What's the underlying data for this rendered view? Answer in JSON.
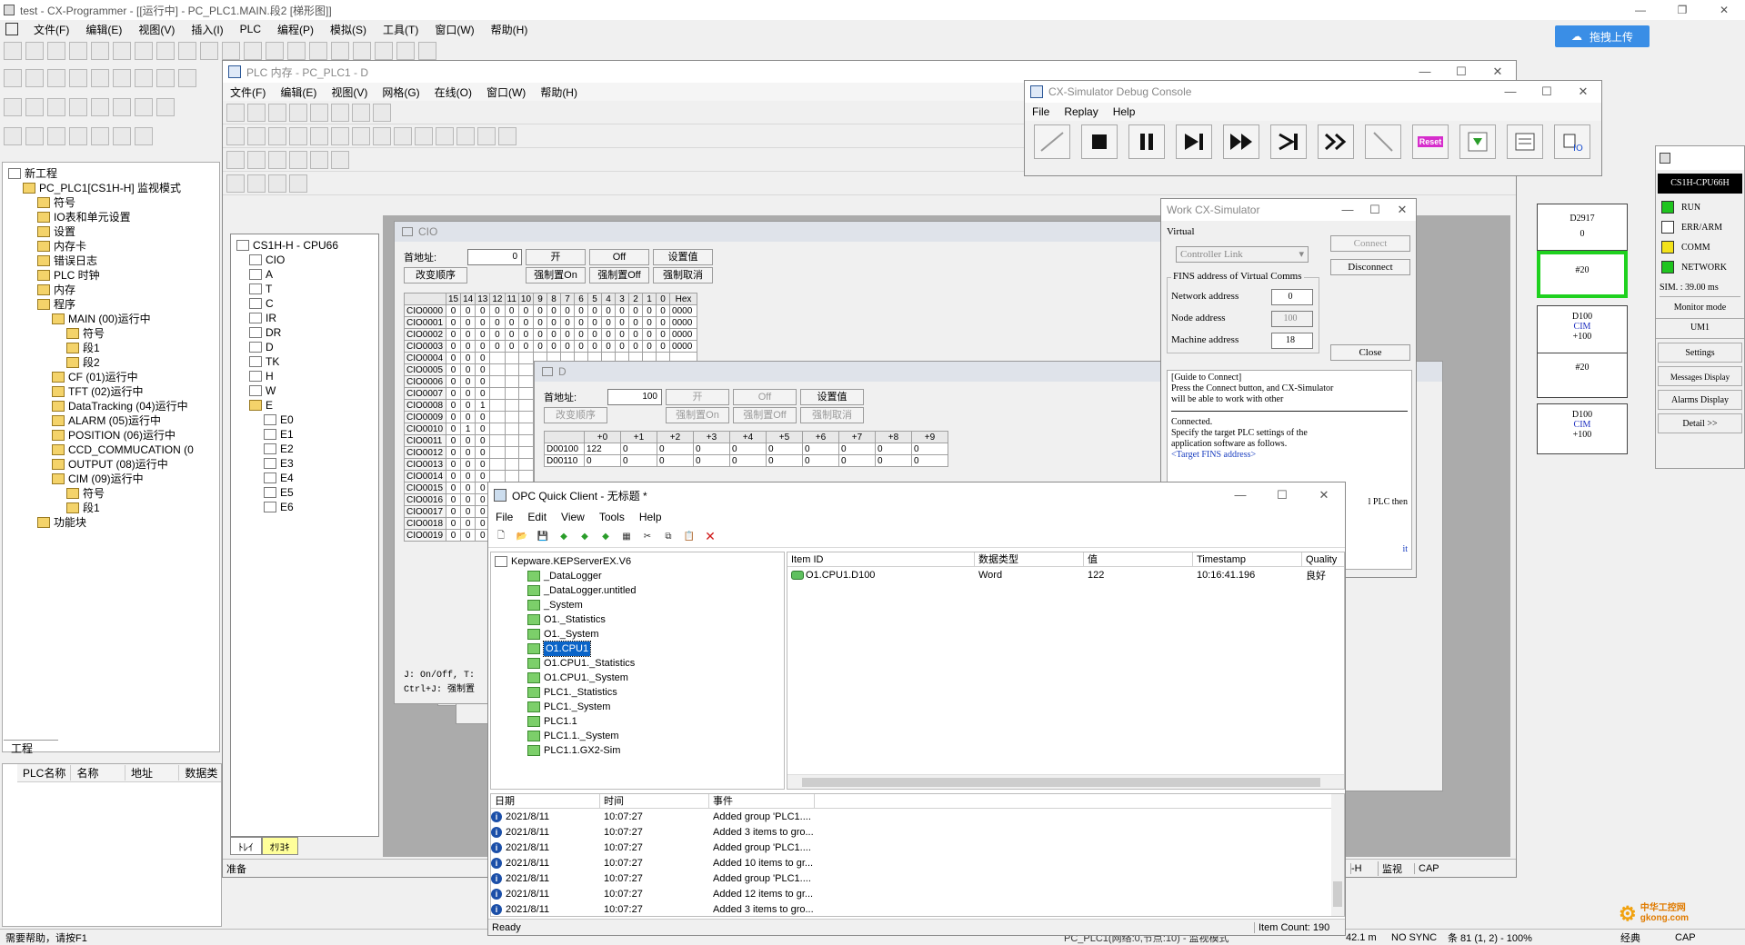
{
  "main_window": {
    "title": "test - CX-Programmer - [[运行中] - PC_PLC1.MAIN.段2 [梯形图]]",
    "menu": [
      "文件(F)",
      "编辑(E)",
      "视图(V)",
      "插入(I)",
      "PLC",
      "编程(P)",
      "模拟(S)",
      "工具(T)",
      "窗口(W)",
      "帮助(H)"
    ],
    "upload_button": "拖拽上传",
    "status_help": "需要帮助，请按F1",
    "status_right": {
      "plc_info": "PC_PLC1(网络:0,节点:10) - 监视模式",
      "time": "42.1 m",
      "sync": "NO SYNC",
      "position": "条 81 (1, 2)  - 100%",
      "mode": "经典",
      "cap": "CAP"
    }
  },
  "project_tree": {
    "items": [
      {
        "label": "新工程",
        "indent": 0
      },
      {
        "label": "PC_PLC1[CS1H-H] 监视模式",
        "indent": 1
      },
      {
        "label": "符号",
        "indent": 2
      },
      {
        "label": "IO表和单元设置",
        "indent": 2
      },
      {
        "label": "设置",
        "indent": 2
      },
      {
        "label": "内存卡",
        "indent": 2
      },
      {
        "label": "错误日志",
        "indent": 2
      },
      {
        "label": "PLC 时钟",
        "indent": 2
      },
      {
        "label": "内存",
        "indent": 2
      },
      {
        "label": "程序",
        "indent": 2
      },
      {
        "label": "MAIN (00)运行中",
        "indent": 3
      },
      {
        "label": "符号",
        "indent": 4
      },
      {
        "label": "段1",
        "indent": 4
      },
      {
        "label": "段2",
        "indent": 4
      },
      {
        "label": "CF (01)运行中",
        "indent": 3
      },
      {
        "label": "TFT (02)运行中",
        "indent": 3
      },
      {
        "label": "DataTracking (04)运行中",
        "indent": 3
      },
      {
        "label": "ALARM (05)运行中",
        "indent": 3
      },
      {
        "label": "POSITION (06)运行中",
        "indent": 3
      },
      {
        "label": "CCD_COMMUCATION (0",
        "indent": 3
      },
      {
        "label": "OUTPUT (08)运行中",
        "indent": 3
      },
      {
        "label": "CIM (09)运行中",
        "indent": 3
      },
      {
        "label": "符号",
        "indent": 4
      },
      {
        "label": "段1",
        "indent": 4
      },
      {
        "label": "功能块",
        "indent": 2
      }
    ],
    "tab": "工程"
  },
  "symbol_table": {
    "headers": [
      "PLC名称",
      "名称",
      "地址",
      "数据类"
    ]
  },
  "plc_memory": {
    "title": "PLC 内存 - PC_PLC1 - D",
    "menu": [
      "文件(F)",
      "编辑(E)",
      "视图(V)",
      "网格(G)",
      "在线(O)",
      "窗口(W)",
      "帮助(H)"
    ],
    "tree_root": "CS1H-H - CPU66",
    "areas": [
      "CIO",
      "A",
      "T",
      "C",
      "IR",
      "DR",
      "D",
      "TK",
      "H",
      "W",
      "E",
      "E0",
      "E1",
      "E2",
      "E3",
      "E4",
      "E5",
      "E6"
    ],
    "tabs": [
      "ﾄﾚｲ",
      "ｵﾘﾖｷ"
    ],
    "status": "准备",
    "status_right": [
      "-H",
      "监视",
      "CAP"
    ]
  },
  "cio_window": {
    "title": "CIO",
    "start_label": "首地址:",
    "start_value": "0",
    "buttons_row1": [
      "开",
      "Off",
      "设置值"
    ],
    "buttons_row2": [
      "改变顺序",
      "强制置On",
      "强制置Off",
      "强制取消"
    ],
    "bit_headers": [
      "15",
      "14",
      "13",
      "12",
      "11",
      "10",
      "9",
      "8",
      "7",
      "6",
      "5",
      "4",
      "3",
      "2",
      "1",
      "0",
      "Hex"
    ],
    "rows": [
      {
        "addr": "CIO0000",
        "bits": [
          "0",
          "0",
          "0",
          "0",
          "0",
          "0",
          "0",
          "0",
          "0",
          "0",
          "0",
          "0",
          "0",
          "0",
          "0",
          "0"
        ],
        "hex": "0000"
      },
      {
        "addr": "CIO0001",
        "bits": [
          "0",
          "0",
          "0",
          "0",
          "0",
          "0",
          "0",
          "0",
          "0",
          "0",
          "0",
          "0",
          "0",
          "0",
          "0",
          "0"
        ],
        "hex": "0000"
      },
      {
        "addr": "CIO0002",
        "bits": [
          "0",
          "0",
          "0",
          "0",
          "0",
          "0",
          "0",
          "0",
          "0",
          "0",
          "0",
          "0",
          "0",
          "0",
          "0",
          "0"
        ],
        "hex": "0000"
      },
      {
        "addr": "CIO0003",
        "bits": [
          "0",
          "0",
          "0",
          "0",
          "0",
          "0",
          "0",
          "0",
          "0",
          "0",
          "0",
          "0",
          "0",
          "0",
          "0",
          "0"
        ],
        "hex": "0000"
      },
      {
        "addr": "CIO0004",
        "bits": [
          "0",
          "0",
          "0",
          "",
          "",
          "",
          "",
          "",
          "",
          "",
          "",
          "",
          "",
          "",
          "",
          ""
        ],
        "hex": ""
      },
      {
        "addr": "CIO0005",
        "bits": [
          "0",
          "0",
          "0"
        ],
        "hex": ""
      },
      {
        "addr": "CIO0006",
        "bits": [
          "0",
          "0",
          "0"
        ],
        "hex": ""
      },
      {
        "addr": "CIO0007",
        "bits": [
          "0",
          "0",
          "0"
        ],
        "hex": ""
      },
      {
        "addr": "CIO0008",
        "bits": [
          "0",
          "0",
          "1"
        ],
        "hex": ""
      },
      {
        "addr": "CIO0009",
        "bits": [
          "0",
          "0",
          "0"
        ],
        "hex": ""
      },
      {
        "addr": "CIO0010",
        "bits": [
          "0",
          "1",
          "0"
        ],
        "hex": ""
      },
      {
        "addr": "CIO0011",
        "bits": [
          "0",
          "0",
          "0"
        ],
        "hex": ""
      },
      {
        "addr": "CIO0012",
        "bits": [
          "0",
          "0",
          "0"
        ],
        "hex": ""
      },
      {
        "addr": "CIO0013",
        "bits": [
          "0",
          "0",
          "0"
        ],
        "hex": ""
      },
      {
        "addr": "CIO0014",
        "bits": [
          "0",
          "0",
          "0"
        ],
        "hex": ""
      },
      {
        "addr": "CIO0015",
        "bits": [
          "0",
          "0",
          "0"
        ],
        "hex": ""
      },
      {
        "addr": "CIO0016",
        "bits": [
          "0",
          "0",
          "0"
        ],
        "hex": ""
      },
      {
        "addr": "CIO0017",
        "bits": [
          "0",
          "0",
          "0"
        ],
        "hex": ""
      },
      {
        "addr": "CIO0018",
        "bits": [
          "0",
          "0",
          "0"
        ],
        "hex": ""
      },
      {
        "addr": "CIO0019",
        "bits": [
          "0",
          "0",
          "0"
        ],
        "hex": ""
      }
    ],
    "hint1": "J: On/Off,  T:",
    "hint2": "Ctrl+J: 强制置"
  },
  "d_window": {
    "title": "D",
    "start_label": "首地址:",
    "start_value": "100",
    "buttons_row1": [
      "开",
      "Off",
      "设置值"
    ],
    "buttons_row2": [
      "改变顺序",
      "强制置On",
      "强制置Off",
      "强制取消"
    ],
    "col_headers": [
      "+0",
      "+1",
      "+2",
      "+3",
      "+4",
      "+5",
      "+6",
      "+7",
      "+8",
      "+9"
    ],
    "rows": [
      {
        "addr": "D00100",
        "values": [
          "122",
          "0",
          "0",
          "0",
          "0",
          "0",
          "0",
          "0",
          "0",
          "0"
        ]
      },
      {
        "addr": "D00110",
        "values": [
          "0",
          "0",
          "0",
          "0",
          "0",
          "0",
          "0",
          "0",
          "0",
          "0"
        ]
      }
    ]
  },
  "debug_console": {
    "title": "CX-Simulator Debug Console",
    "menu": [
      "File",
      "Replay",
      "Help"
    ],
    "reset_label": "Reset"
  },
  "work_sim": {
    "title": "Work CX-Simulator",
    "virtual_label": "Virtual",
    "controller_link": "Controller Link",
    "connect": "Connect",
    "disconnect": "Disconnect",
    "fins_label": "FINS address of Virtual Comms",
    "network_label": "Network address",
    "network_value": "0",
    "node_label": "Node address",
    "node_value": "100",
    "machine_label": "Machine address",
    "machine_value": "18",
    "close": "Close",
    "guide_lines": [
      "[Guide to Connect]",
      "Press the Connect button, and CX-Simulator",
      "will be able to work with other"
    ],
    "connected_lines": [
      "Connected.",
      "Specify the target PLC settings of the",
      "application software as follows."
    ],
    "target_fins": "<Target FINS address>",
    "frag_then": "l PLC then",
    "frag_it": "it"
  },
  "sim_panel": {
    "model": "CS1H-CPU66H",
    "leds": [
      {
        "label": "RUN",
        "color": "#1fc41f"
      },
      {
        "label": "ERR/ARM",
        "color": "#ffffff"
      },
      {
        "label": "COMM",
        "color": "#f3e21a"
      },
      {
        "label": "NETWORK",
        "color": "#1fc41f"
      }
    ],
    "sim_time": "SIM. : 39.00 ms",
    "monitor_mode": "Monitor mode",
    "um": "UM1",
    "settings": "Settings",
    "messages": "Messages Display",
    "alarms": "Alarms Display",
    "detail": "Detail >>"
  },
  "ladder_cells": [
    {
      "top": "D2917",
      "bottom": "0"
    },
    {
      "top": "#20",
      "bottom": ""
    },
    {
      "top": "D100",
      "mid": "CIM",
      "bottom": "+100"
    },
    {
      "top": "#20",
      "bottom": ""
    },
    {
      "top": "D100",
      "mid": "CIM",
      "bottom": "+100"
    }
  ],
  "opc": {
    "title": "OPC Quick Client - 无标题 *",
    "menu": [
      "File",
      "Edit",
      "View",
      "Tools",
      "Help"
    ],
    "tree": [
      {
        "label": "Kepware.KEPServerEX.V6",
        "indent": 0
      },
      {
        "label": "_DataLogger",
        "indent": 1
      },
      {
        "label": "_DataLogger.untitled",
        "indent": 1
      },
      {
        "label": "_System",
        "indent": 1
      },
      {
        "label": "O1._Statistics",
        "indent": 1
      },
      {
        "label": "O1._System",
        "indent": 1
      },
      {
        "label": "O1.CPU1",
        "indent": 1,
        "selected": true
      },
      {
        "label": "O1.CPU1._Statistics",
        "indent": 1
      },
      {
        "label": "O1.CPU1._System",
        "indent": 1
      },
      {
        "label": "PLC1._Statistics",
        "indent": 1
      },
      {
        "label": "PLC1._System",
        "indent": 1
      },
      {
        "label": "PLC1.1",
        "indent": 1
      },
      {
        "label": "PLC1.1._System",
        "indent": 1
      },
      {
        "label": "PLC1.1.GX2-Sim",
        "indent": 1
      }
    ],
    "item_headers": [
      "Item ID",
      "数据类型",
      "值",
      "Timestamp",
      "Quality"
    ],
    "items": [
      {
        "id": "O1.CPU1.D100",
        "type": "Word",
        "value": "122",
        "ts": "10:16:41.196",
        "quality": "良好"
      }
    ],
    "log_headers": [
      "日期",
      "时间",
      "事件"
    ],
    "log": [
      {
        "date": "2021/8/11",
        "time": "10:07:27",
        "event": "Added group 'PLC1...."
      },
      {
        "date": "2021/8/11",
        "time": "10:07:27",
        "event": "Added 3 items to gro..."
      },
      {
        "date": "2021/8/11",
        "time": "10:07:27",
        "event": "Added group 'PLC1...."
      },
      {
        "date": "2021/8/11",
        "time": "10:07:27",
        "event": "Added 10 items to gr..."
      },
      {
        "date": "2021/8/11",
        "time": "10:07:27",
        "event": "Added group 'PLC1...."
      },
      {
        "date": "2021/8/11",
        "time": "10:07:27",
        "event": "Added 12 items to gr..."
      },
      {
        "date": "2021/8/11",
        "time": "10:07:27",
        "event": "Added 3 items to gro..."
      }
    ],
    "status_ready": "Ready",
    "item_count": "Item Count: 190"
  },
  "watermark": "中华工控网\ngkong.com"
}
